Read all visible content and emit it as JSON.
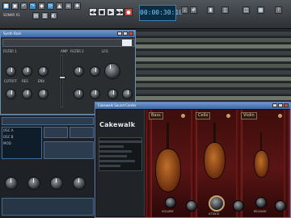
{
  "control_bar": {
    "time_display": "00:00:30:10",
    "left_label": "SONAR X1",
    "icons": [
      "app-icon",
      "save-icon",
      "undo-icon",
      "redo-icon",
      "snap-icon",
      "loop-icon",
      "record-icon",
      "play-icon",
      "stop-icon",
      "rewind-icon",
      "forward-icon",
      "metronome-icon",
      "mixer-icon",
      "settings-icon"
    ]
  },
  "synth_window": {
    "title": "Synth Rack",
    "section_labels": [
      "FILTER 1",
      "FILTER 2",
      "AMP",
      "LFO"
    ],
    "knob_labels": [
      "CUTOFF",
      "RES",
      "ENV",
      "DRIVE",
      "CUTOFF",
      "RES",
      "ENV",
      "LEVEL"
    ]
  },
  "lower_left": {
    "panel_labels": [
      "OSC A",
      "OSC B",
      "MOD"
    ]
  },
  "strings_window": {
    "title": "Cakewalk Sound Center",
    "brand": "Cakewalk",
    "sections": [
      "Bass",
      "Cello",
      "Violin"
    ],
    "knob_labels": [
      "VOLUME",
      "ATTACK",
      "RELEASE"
    ]
  },
  "colors": {
    "accent_blue": "#3a6aa4",
    "stage_red": "#5a1414",
    "time_display": "#7ad0ff"
  }
}
